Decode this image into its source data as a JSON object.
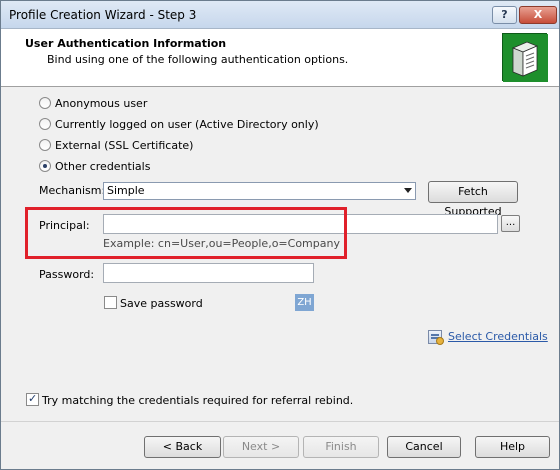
{
  "window": {
    "title": "Profile Creation Wizard - Step 3",
    "help_button": "?",
    "close_button": "X"
  },
  "header": {
    "title": "User Authentication Information",
    "subtitle": "Bind using one of the following authentication options.",
    "icon": "server-icon"
  },
  "auth_options": [
    {
      "label": "Anonymous user",
      "checked": false
    },
    {
      "label": "Currently logged on user (Active Directory only)",
      "checked": false
    },
    {
      "label": "External (SSL Certificate)",
      "checked": false
    },
    {
      "label": "Other credentials",
      "checked": true
    }
  ],
  "mechanism": {
    "label": "Mechanism:",
    "value": "Simple",
    "fetch_button": "Fetch Supported"
  },
  "principal": {
    "label": "Principal:",
    "value": "",
    "browse_button": "...",
    "example": "Example: cn=User,ou=People,o=Company"
  },
  "password": {
    "label": "Password:",
    "value": "",
    "save_label": "Save password",
    "save_checked": false,
    "ime_badge": "ZH"
  },
  "select_credentials_link": "Select Credentials",
  "referral": {
    "label": "Try matching the credentials required for referral rebind.",
    "checked": true
  },
  "footer": {
    "back": "< Back",
    "next": "Next >",
    "finish": "Finish",
    "cancel": "Cancel",
    "help": "Help"
  },
  "colors": {
    "highlight_box": "#e0202a",
    "link": "#2b5aa8"
  }
}
